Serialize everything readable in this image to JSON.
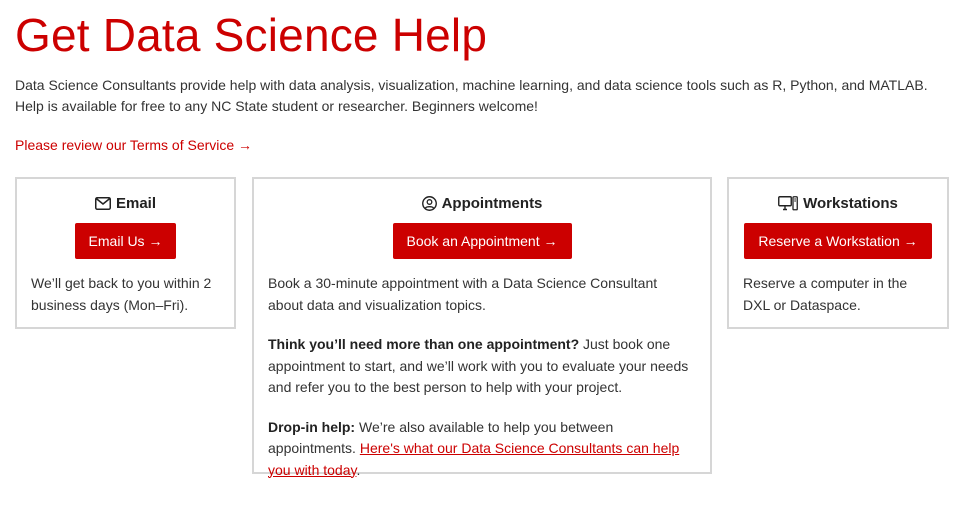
{
  "header": {
    "title": "Get Data Science Help",
    "intro": "Data Science Consultants provide help with data analysis, visualization, machine learning, and data science tools such as R, Python, and MATLAB. Help is available for free to any NC State student or researcher. Beginners welcome!",
    "tos_link": "Please review our Terms of Service →"
  },
  "colors": {
    "accent": "#cc0000",
    "border": "#d6d6d6",
    "text": "#333333"
  },
  "cards": {
    "email": {
      "icon": "envelope-icon",
      "title": "Email",
      "button": "Email Us →",
      "text": "We’ll get back to you within 2 business days (Mon–Fri)."
    },
    "appointments": {
      "icon": "user-circle-icon",
      "title": "Appointments",
      "button": "Book an Appointment →",
      "text": "Book a 30-minute appointment with a Data Science Consultant about data and visualization topics.",
      "more_bold": "Think you’ll need more than one appointment?",
      "more_text": " Just book one appointment to start, and we’ll work with you to evaluate your needs and refer you to the best person to help with your project.",
      "dropin_bold": "Drop-in help:",
      "dropin_text": " We’re also available to help you between appointments.",
      "dropin_link": "Here's what our Data Science Consultants can help you with today",
      "dropin_end": "."
    },
    "workstations": {
      "icon": "computer-icon",
      "title": "Workstations",
      "button": "Reserve a Workstation →",
      "text": "Reserve a computer in the DXL or Dataspace."
    }
  }
}
